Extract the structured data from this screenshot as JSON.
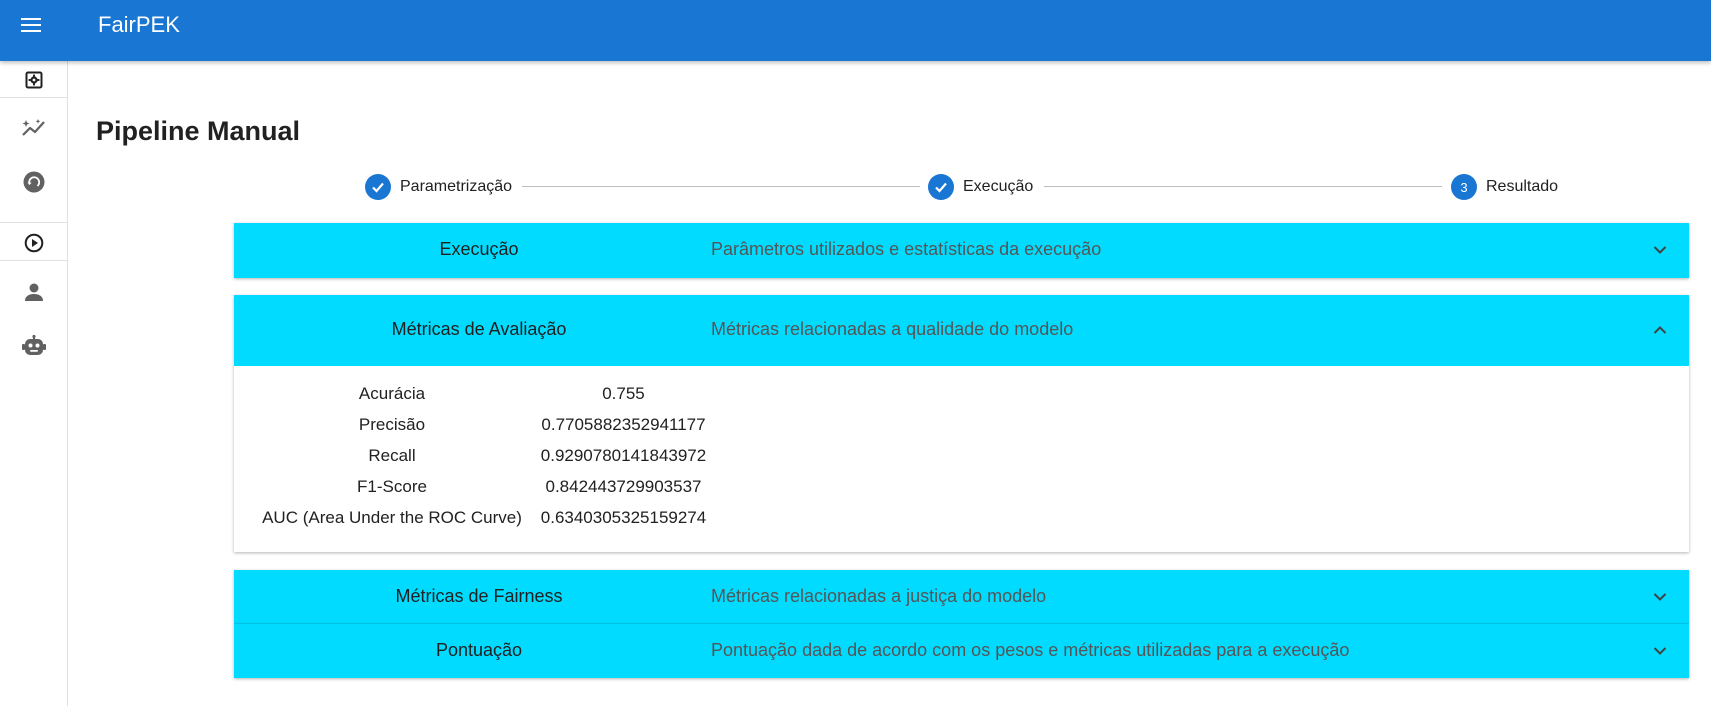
{
  "app": {
    "title": "FairPEK"
  },
  "drawer": {
    "items": [
      {
        "icon": "settings-box-icon"
      },
      {
        "icon": "chart-sparkle-icon"
      },
      {
        "icon": "history-circle-icon"
      },
      {
        "icon": "play-circle-icon"
      },
      {
        "icon": "person-icon"
      },
      {
        "icon": "robot-icon"
      }
    ]
  },
  "page": {
    "title": "Pipeline Manual"
  },
  "stepper": {
    "steps": [
      {
        "label": "Parametrização",
        "state": "completed",
        "icon": "check-icon"
      },
      {
        "label": "Execução",
        "state": "completed",
        "icon": "check-icon"
      },
      {
        "label": "Resultado",
        "state": "active",
        "number": "3"
      }
    ]
  },
  "panels": [
    {
      "title": "Execução",
      "description": "Parâmetros utilizados e estatísticas da execução",
      "expanded": false
    },
    {
      "title": "Métricas de Avaliação",
      "description": "Métricas relacionadas a qualidade do modelo",
      "expanded": true,
      "metrics": [
        {
          "name": "Acurácia",
          "value": "0.755"
        },
        {
          "name": "Precisão",
          "value": "0.7705882352941177"
        },
        {
          "name": "Recall",
          "value": "0.9290780141843972"
        },
        {
          "name": "F1-Score",
          "value": "0.842443729903537"
        },
        {
          "name": "AUC (Area Under the ROC Curve)",
          "value": "0.6340305325159274"
        }
      ]
    },
    {
      "title": "Métricas de Fairness",
      "description": "Métricas relacionadas a justiça do modelo",
      "expanded": false
    },
    {
      "title": "Pontuação",
      "description": "Pontuação dada de acordo com os pesos e métricas utilizadas para a execução",
      "expanded": false
    }
  ],
  "colors": {
    "primary": "#1976d2",
    "panel_header": "#00dbff",
    "icon_gray": "#616161"
  }
}
